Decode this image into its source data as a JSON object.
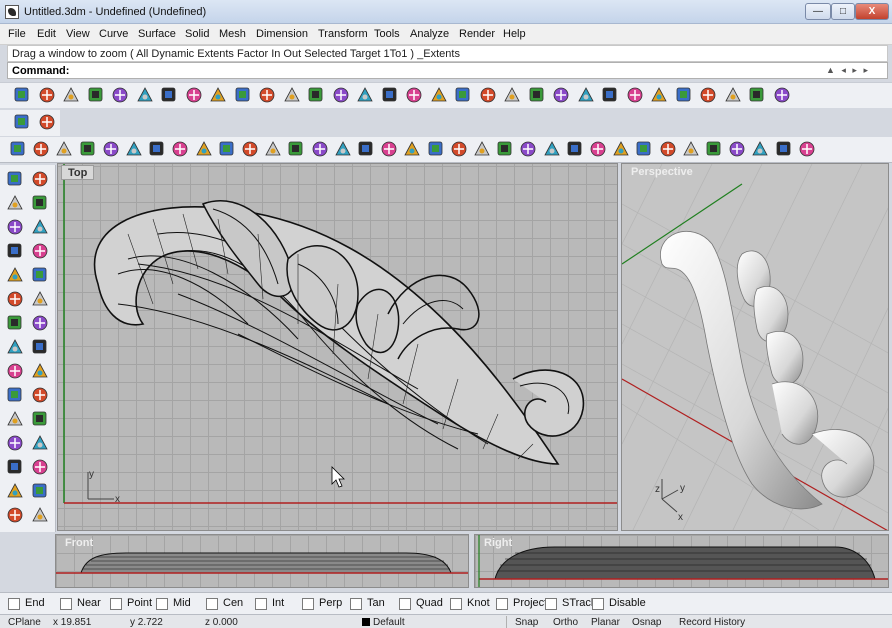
{
  "window": {
    "title": "Untitled.3dm - Undefined (Undefined)",
    "min_glyph": "—",
    "max_glyph": "□",
    "close_glyph": "X"
  },
  "menu": [
    "File",
    "Edit",
    "View",
    "Curve",
    "Surface",
    "Solid",
    "Mesh",
    "Dimension",
    "Transform",
    "Tools",
    "Analyze",
    "Render",
    "Help"
  ],
  "command": {
    "history": "Drag a window to zoom ( All  Dynamic  Extents  Factor  In  Out  Selected  Target  1To1 ) _Extents",
    "label": "Command:",
    "value": ""
  },
  "toolbars": {
    "standard": [
      "new-file-icon",
      "open-folder-icon",
      "save-icon",
      "print-icon",
      "import-icon",
      "cut-icon",
      "copy-icon",
      "paste-icon",
      "undo-icon",
      "pan-hand-icon",
      "rotate-view-icon",
      "zoom-icon",
      "zoom-window-icon",
      "zoom-extents-icon",
      "zoom-selected-icon",
      "undo-view-icon",
      "four-viewports-icon",
      "car-icon",
      "shade-icon",
      "lasso-icon",
      "properties-icon",
      "lightbulb-icon",
      "lock-icon",
      "layer-icon",
      "color-wheel-icon",
      "sphere-icon",
      "rendered-sphere-icon",
      "globe-icon",
      "pen-icon",
      "options-gear-icon",
      "grid-icon",
      "help-icon"
    ],
    "secondary": [
      "brush-icon",
      "help-icon"
    ],
    "main": [
      "box-icon",
      "mesh-box-icon",
      "solid-icon",
      "hatch-icon",
      "curve-tool-icon",
      "gumball-icon",
      "surface-icon",
      "boolean-icon",
      "polygon-icon",
      "extrude-icon",
      "network-icon",
      "rail-icon",
      "loft-icon",
      "blend-icon",
      "fillet-icon",
      "chamfer-icon",
      "array-icon",
      "dimension-icon",
      "window-icon",
      "pipe-icon",
      "cage-icon",
      "grid-toggle-icon",
      "camera-icon",
      "align-icon",
      "flow-icon",
      "twist-icon",
      "bend-icon",
      "smooth-icon",
      "sweep-icon",
      "project-icon",
      "scissors-icon",
      "diamond-icon",
      "point-icon",
      "branch-icon",
      "gear-icon"
    ],
    "left": [
      "select-arrow-icon",
      "point-icon",
      "polyline-icon",
      "curve-icon",
      "circle-icon",
      "ellipse-icon",
      "arc-icon",
      "rectangle-icon",
      "polygon-icon",
      "fillet-icon",
      "surface-icon",
      "surface-edit-icon",
      "box-icon",
      "sphere-icon",
      "cylinder-icon",
      "mesh-icon",
      "transform-icon",
      "explode-icon",
      "move-icon",
      "scale-icon",
      "dim-icon",
      "analyze-icon",
      "curve-edit-icon",
      "blend-icon",
      "text-icon",
      "array-icon",
      "group-icon",
      "block-icon",
      "cube-icon",
      "grid-icon"
    ]
  },
  "viewports": {
    "top": "Top",
    "perspective": "Perspective",
    "front": "Front",
    "right": "Right"
  },
  "axis": {
    "x": "x",
    "y": "y",
    "z": "z"
  },
  "osnaps": [
    {
      "label": "End",
      "checked": false
    },
    {
      "label": "Near",
      "checked": false
    },
    {
      "label": "Point",
      "checked": false
    },
    {
      "label": "Mid",
      "checked": false
    },
    {
      "label": "Cen",
      "checked": false
    },
    {
      "label": "Int",
      "checked": false
    },
    {
      "label": "Perp",
      "checked": false
    },
    {
      "label": "Tan",
      "checked": false
    },
    {
      "label": "Quad",
      "checked": false
    },
    {
      "label": "Knot",
      "checked": false
    },
    {
      "label": "Project",
      "checked": false
    },
    {
      "label": "STrack",
      "checked": false
    },
    {
      "label": "Disable",
      "checked": false
    }
  ],
  "status": {
    "cplane": "CPlane",
    "x": "x 19.851",
    "y": "y 2.722",
    "z": "z 0.000",
    "layer": "Default",
    "snap": "Snap",
    "ortho": "Ortho",
    "planar": "Planar",
    "osnap": "Osnap",
    "record": "Record History"
  },
  "colors": {
    "x_axis": "#b02020",
    "y_axis": "#208020",
    "wire": "#111111",
    "grid": "#a4a4a4"
  }
}
